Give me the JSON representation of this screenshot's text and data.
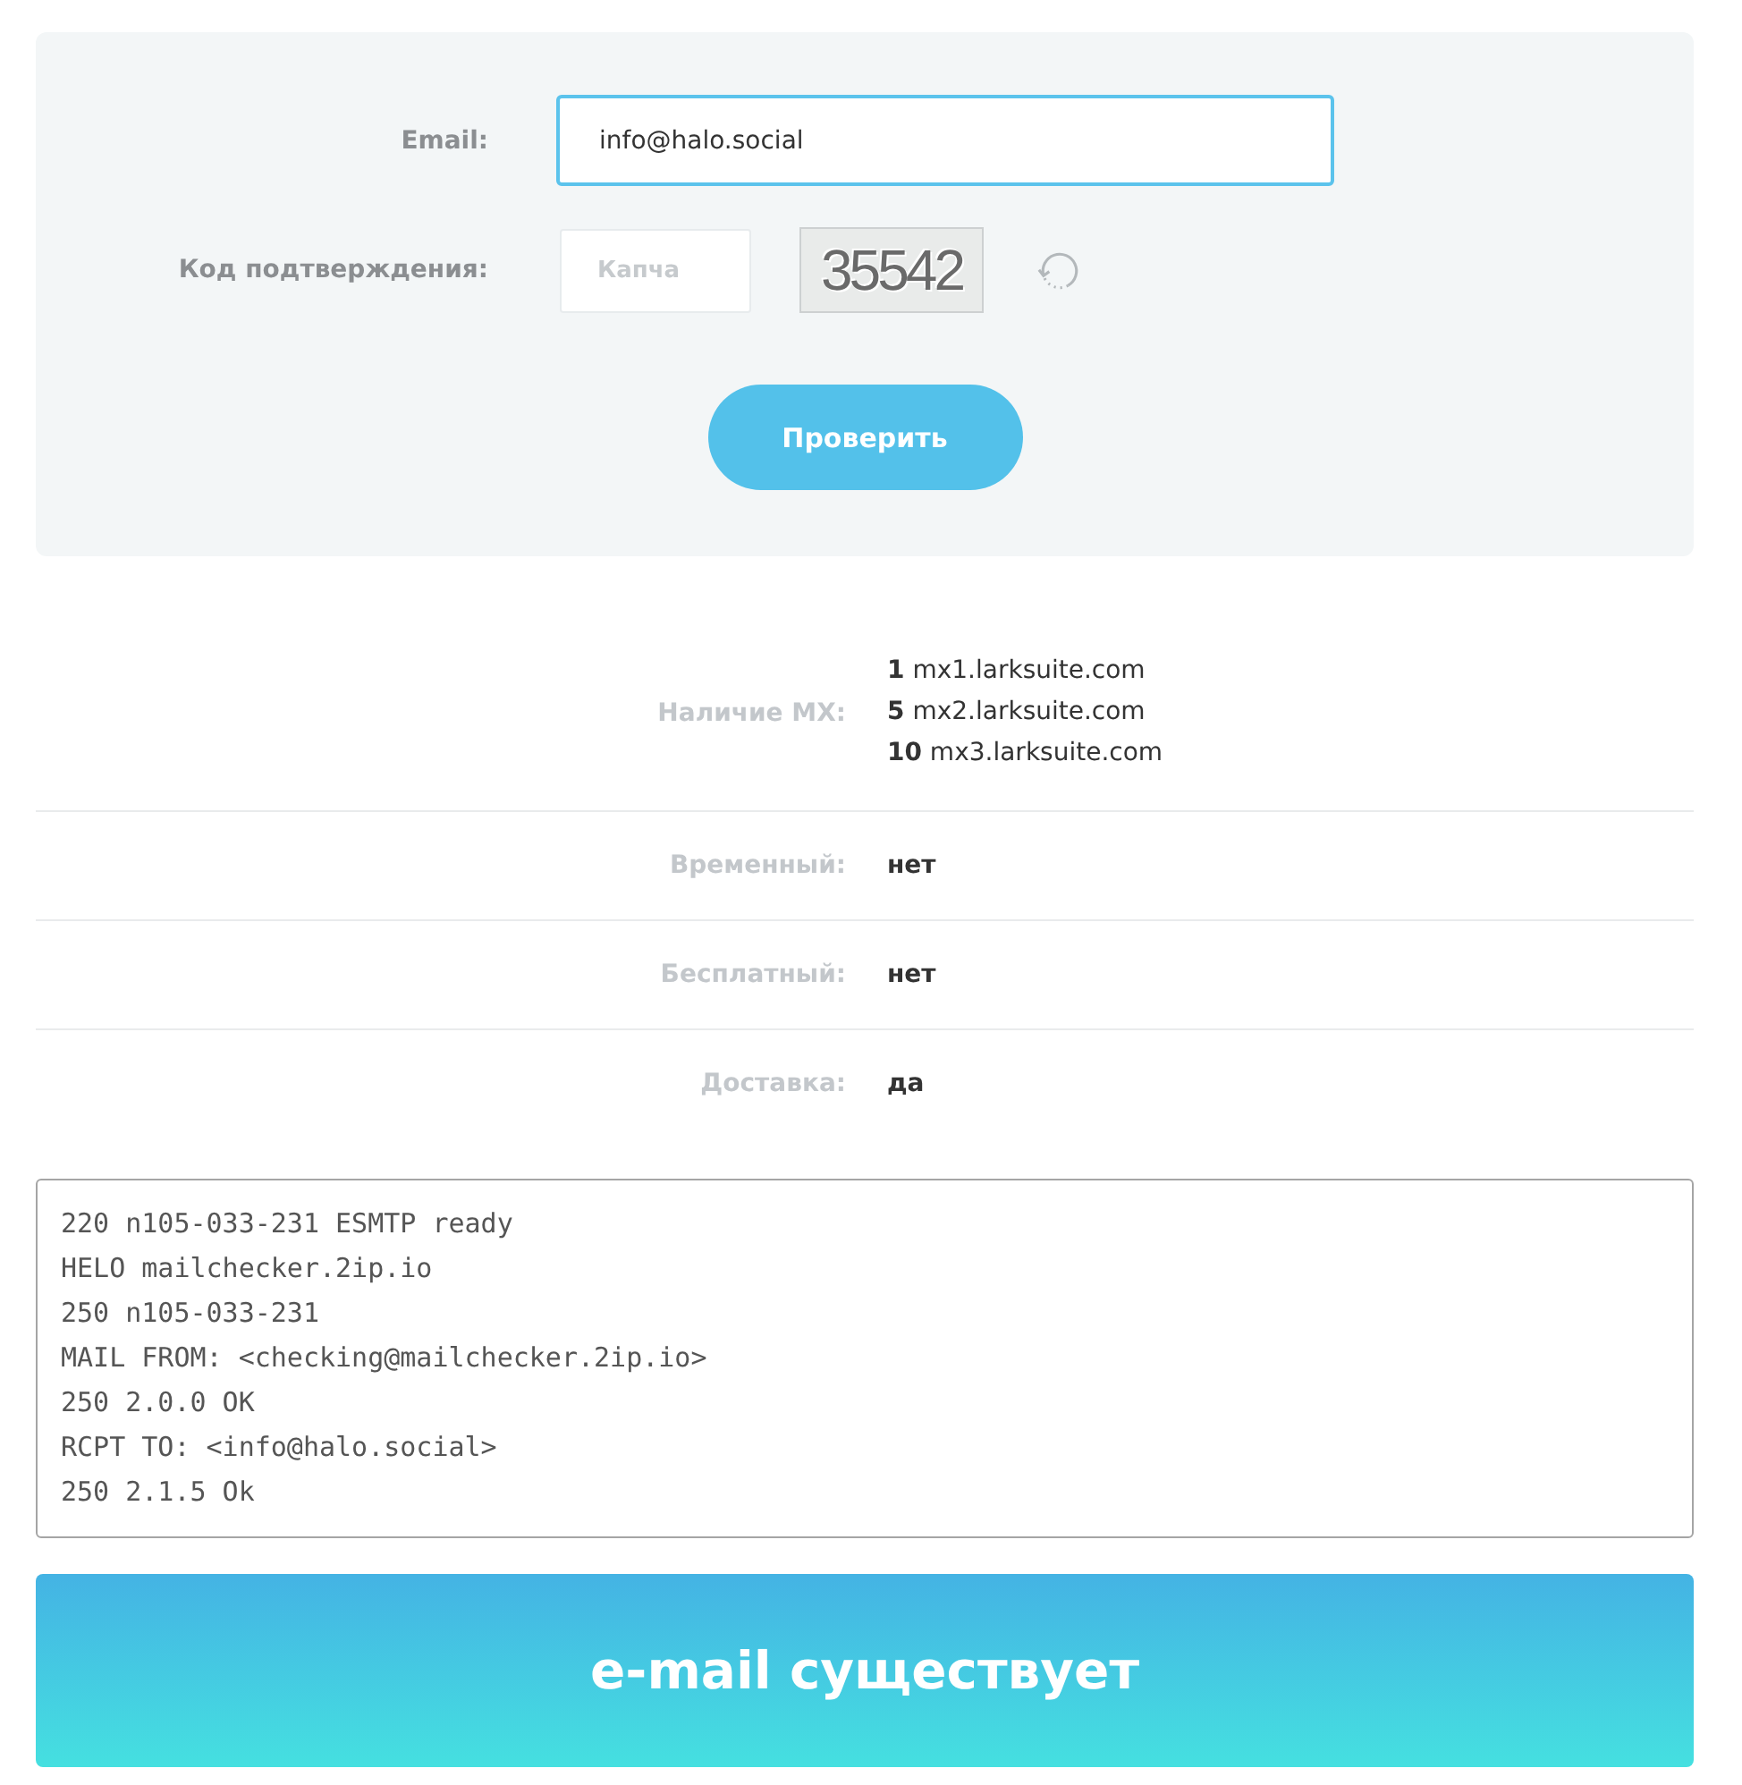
{
  "form": {
    "email": {
      "label": "Email:",
      "value": "info@halo.social",
      "focused": true
    },
    "captcha": {
      "label": "Код подтверждения:",
      "placeholder": "Капча",
      "image_text": "35542"
    },
    "submit": {
      "label": "Проверить"
    }
  },
  "results": [
    {
      "kind": "mx",
      "label": "Наличие MX:",
      "records": [
        "**1** mx1.larksuite.com",
        "**5** mx2.larksuite.com",
        "**10** mx3.larksuite.com"
      ]
    },
    {
      "kind": "text",
      "label": "Временный:",
      "value": "нет"
    },
    {
      "kind": "text",
      "label": "Бесплатный:",
      "value": "нет"
    },
    {
      "kind": "text",
      "label": "Доставка:",
      "value": "да"
    }
  ],
  "smtp_log": {
    "lines": [
      "220 n105-033-231 ESMTP ready",
      "HELO mailchecker.2ip.io",
      "250 n105-033-231",
      "MAIL FROM: <checking@mailchecker.2ip.io>",
      "250 2.0.0 OK",
      "RCPT TO: <info@halo.social>",
      "250 2.1.5 Ok"
    ]
  },
  "verdict": {
    "text": "e-mail существует",
    "success": true
  }
}
